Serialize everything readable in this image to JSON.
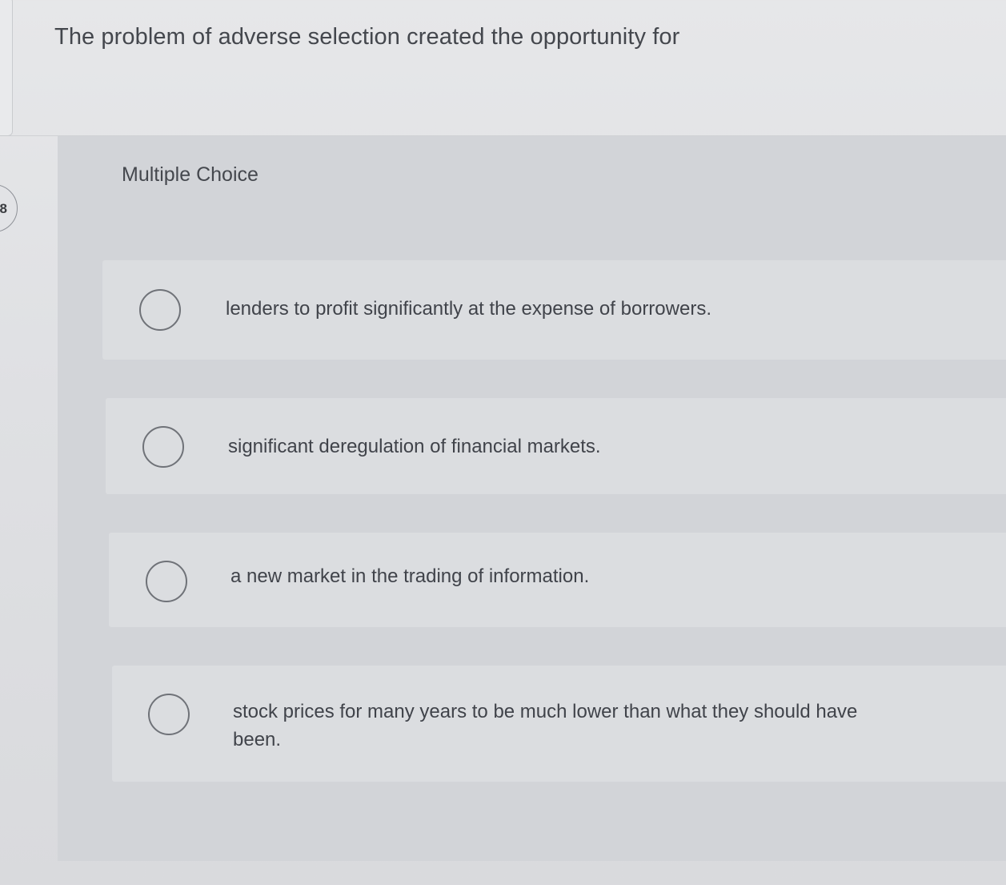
{
  "question": {
    "text": "The problem of adverse selection created the opportunity for",
    "number": "8"
  },
  "choices": {
    "header": "Multiple Choice",
    "options": [
      {
        "label": "lenders to profit significantly at the expense of borrowers."
      },
      {
        "label": "significant deregulation of financial markets."
      },
      {
        "label": "a new market in the trading of information."
      },
      {
        "label": "stock prices for many years to be much lower than what they should have been."
      }
    ]
  }
}
